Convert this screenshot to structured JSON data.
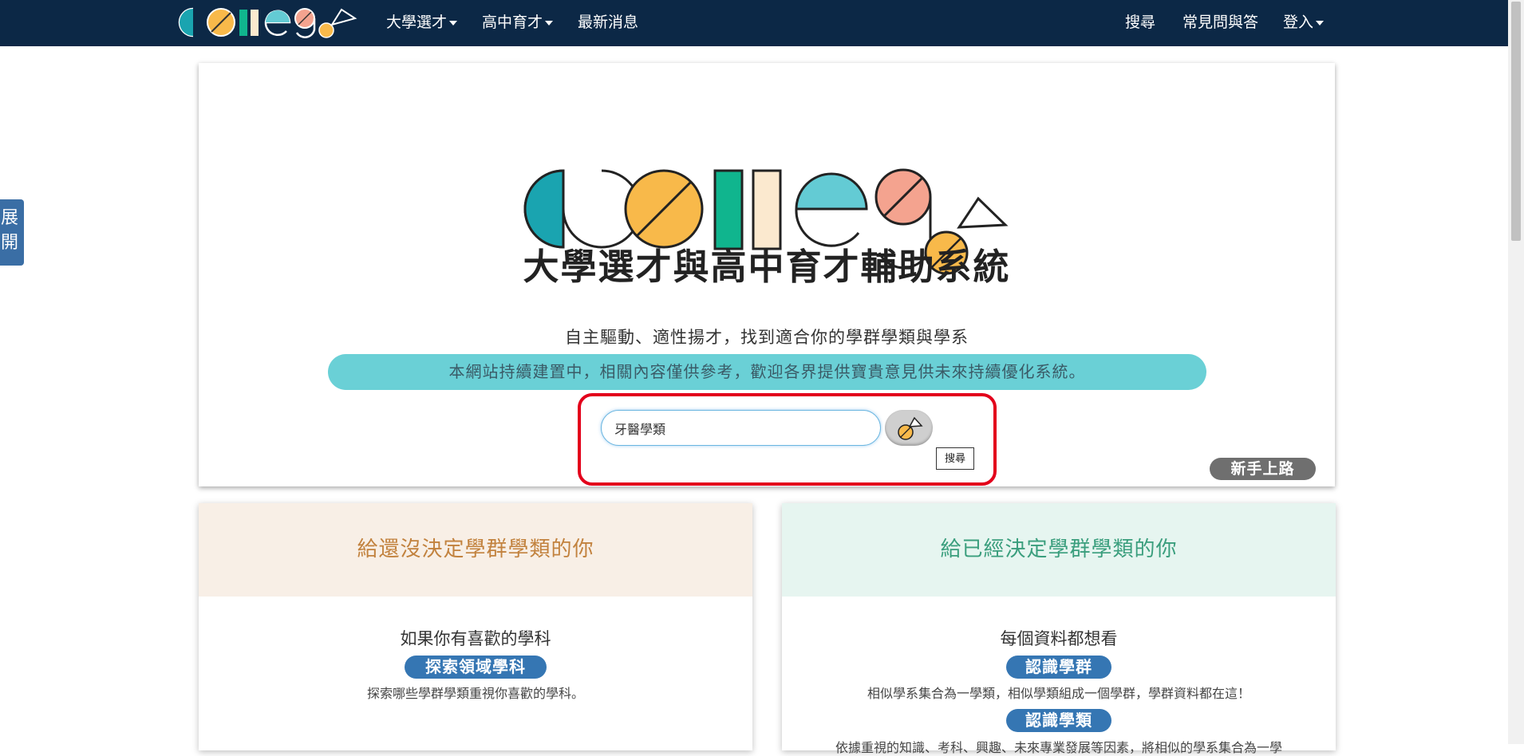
{
  "nav": {
    "items": [
      {
        "label": "大學選才",
        "dropdown": true
      },
      {
        "label": "高中育才",
        "dropdown": true
      },
      {
        "label": "最新消息",
        "dropdown": false
      }
    ],
    "right_items": [
      {
        "label": "搜尋",
        "dropdown": false
      },
      {
        "label": "常見問與答",
        "dropdown": false
      },
      {
        "label": "登入",
        "dropdown": true
      }
    ]
  },
  "side_tab": {
    "label": "展開"
  },
  "hero": {
    "logo_text": "college",
    "title": "大學選才與高中育才輔助系統",
    "tagline": "自主驅動、適性揚才，找到適合你的學群學類與學系",
    "notice": "本網站持續建置中，相關內容僅供參考，歡迎各界提供寶貴意見供未來持續優化系統。",
    "search": {
      "value": "牙醫學類",
      "button_icon": "search-logo-icon",
      "tooltip": "搜尋"
    },
    "newbie_button": "新手上路"
  },
  "cards": {
    "left": {
      "heading": "給還沒決定學群學類的你",
      "subheading": "如果你有喜歡的學科",
      "items": [
        {
          "button": "探索領域學科",
          "desc": "探索哪些學群學類重視你喜歡的學科。"
        }
      ]
    },
    "right": {
      "heading": "給已經決定學群學類的你",
      "subheading": "每個資料都想看",
      "items": [
        {
          "button": "認識學群",
          "desc": "相似學系集合為一學類，相似學類組成一個學群，學群資料都在這！"
        },
        {
          "button": "認識學類",
          "desc": "依據重視的知識、考科、興趣、未來專業發展等因素，將相似的學系集合為一學"
        }
      ]
    }
  },
  "colors": {
    "navbar": "#0c2846",
    "notice_bg": "#6ad0d6",
    "highlight": "#e3001b",
    "pill": "#3576b3",
    "left_head_bg": "#f8efe6",
    "left_head_text": "#c2823e",
    "right_head_bg": "#e6f5f0",
    "right_head_text": "#3a9e7d"
  }
}
